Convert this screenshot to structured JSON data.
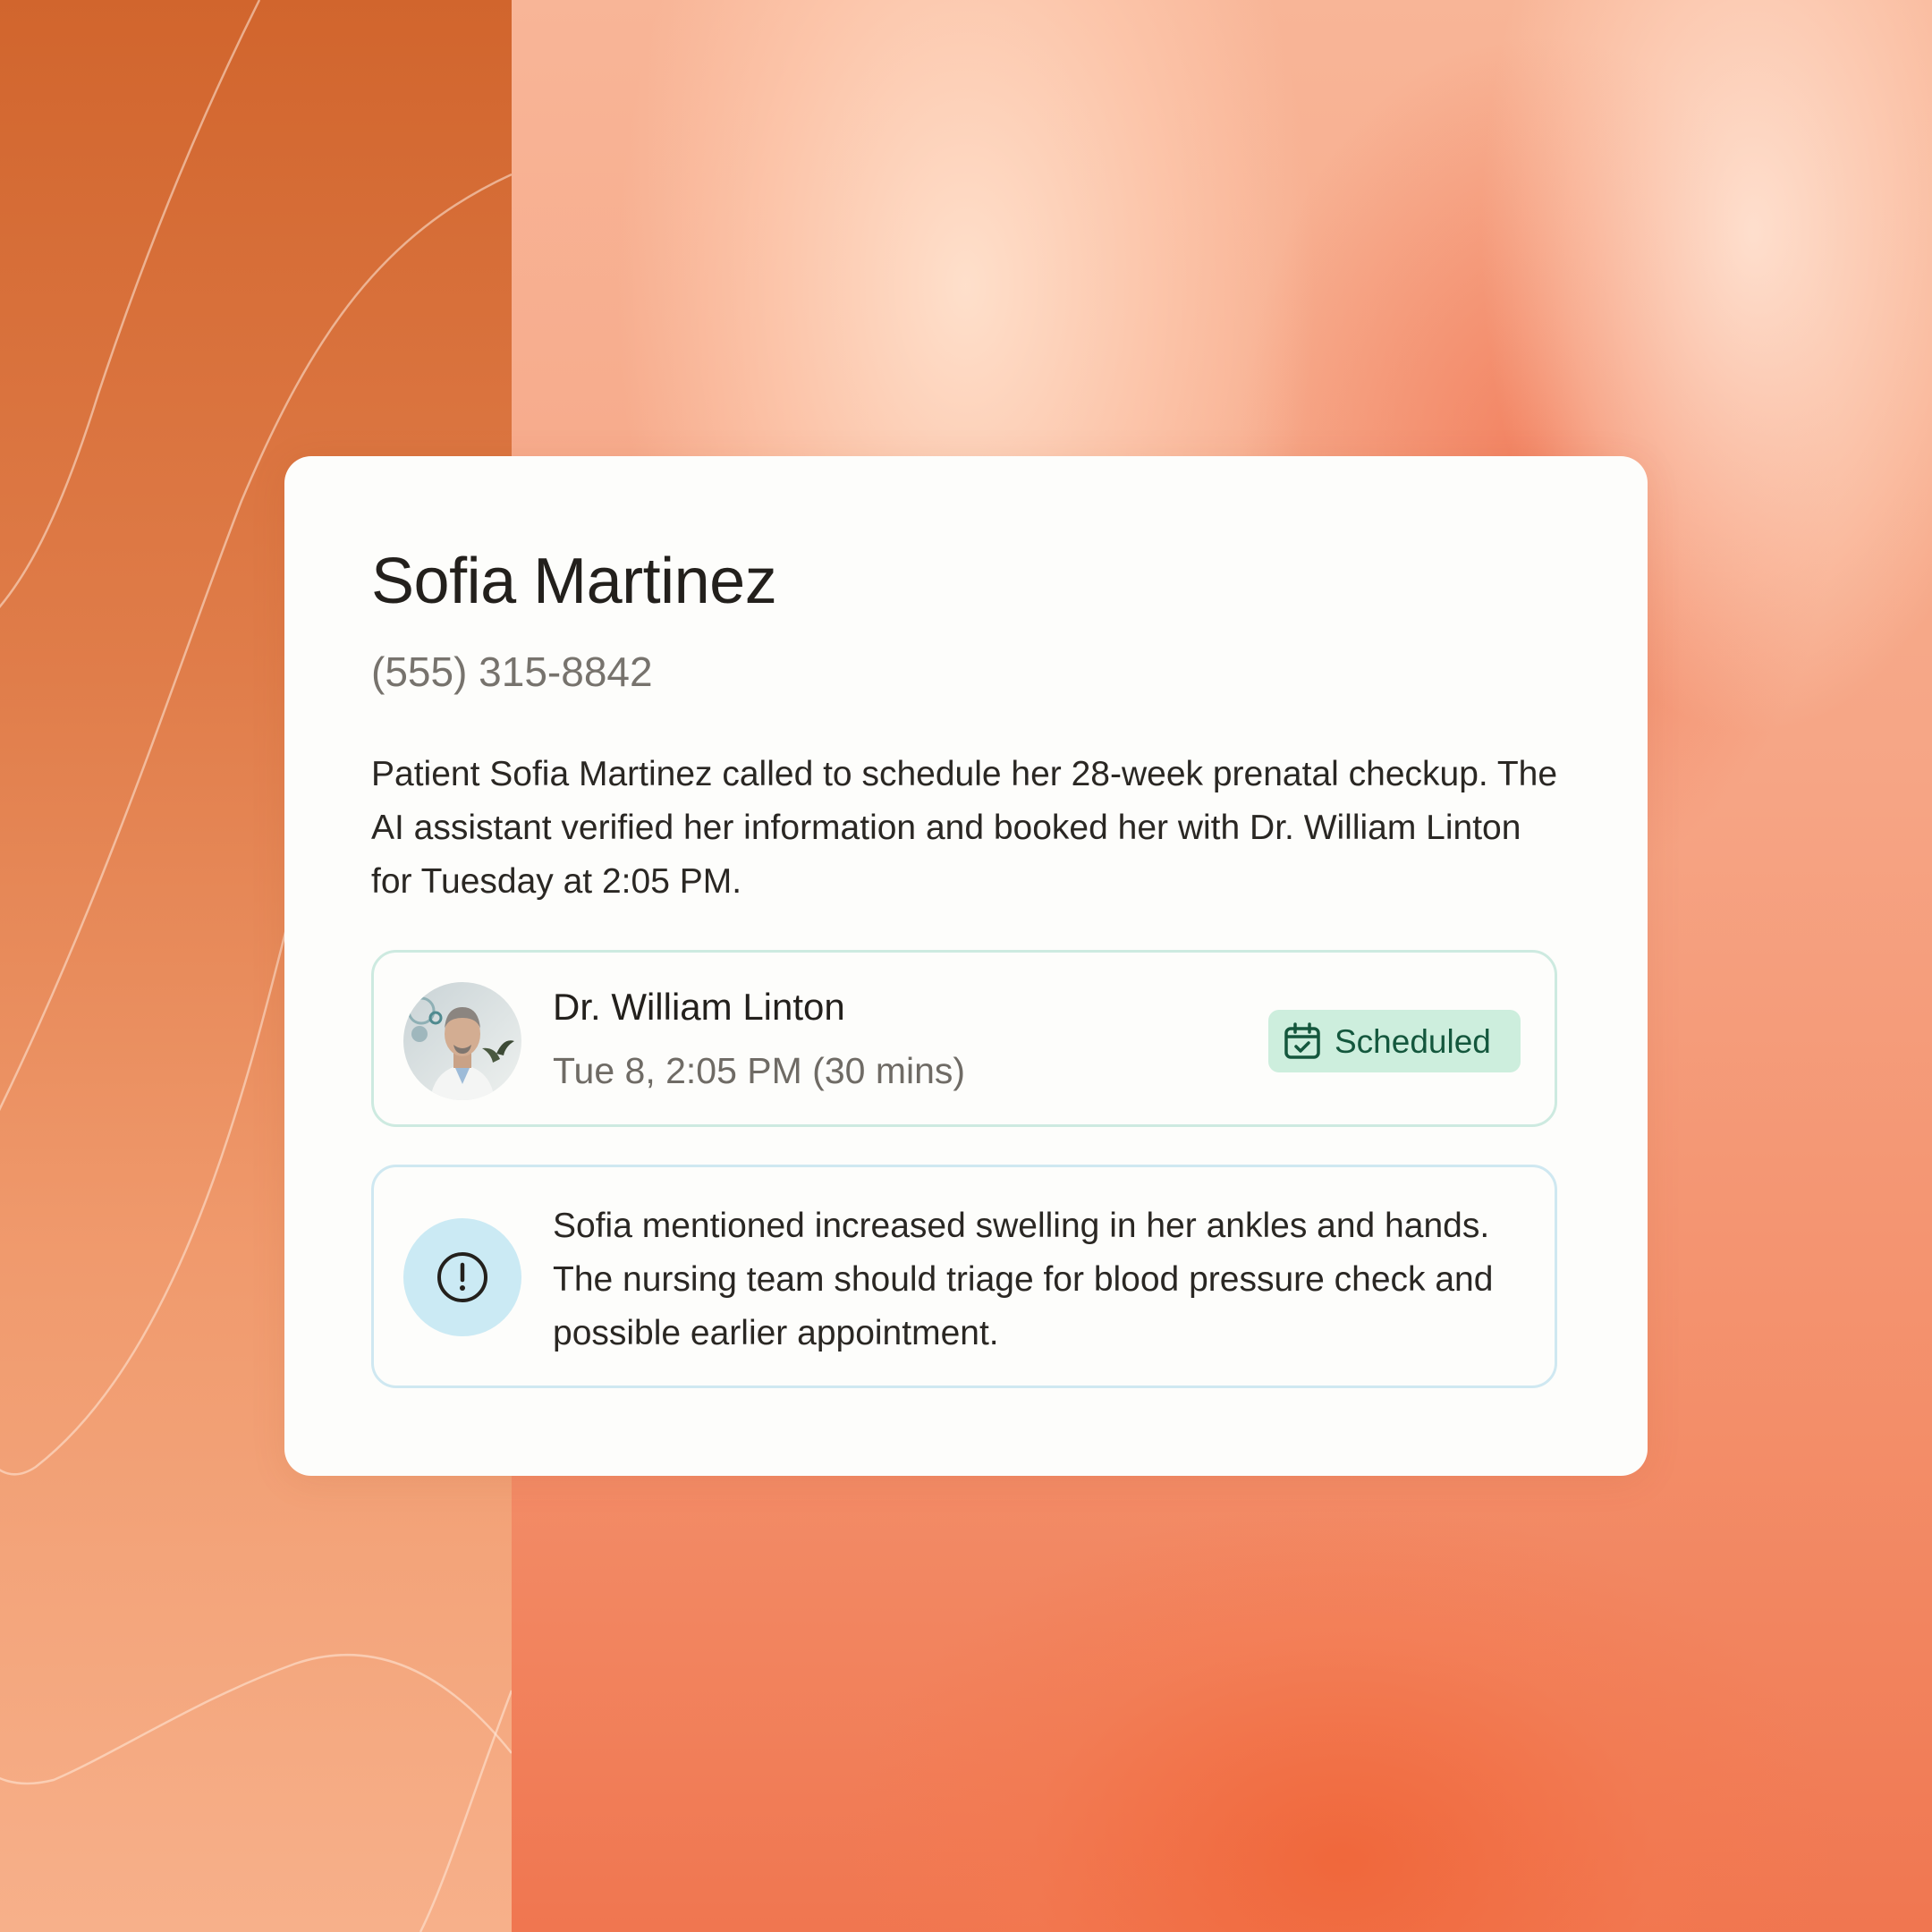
{
  "patient": {
    "name": "Sofia Martinez",
    "phone": "(555) 315-8842"
  },
  "summary": "Patient Sofia Martinez called to schedule her 28-week prenatal checkup. The AI assistant verified her information and booked her with Dr. William Linton for Tuesday at 2:05 PM.",
  "appointment": {
    "doctor_name": "Dr. William Linton",
    "time": "Tue 8, 2:05 PM (30 mins)",
    "status_label": "Scheduled",
    "status_icon": "calendar-check-icon",
    "status_color": "#14573d",
    "status_bg": "#cdeedd"
  },
  "alert": {
    "icon": "exclamation-circle-icon",
    "text": "Sofia mentioned increased swelling in her ankles and hands. The nursing team should triage for blood pressure check and possible earlier appointment."
  },
  "colors": {
    "left_panel": "#d96f38",
    "background": "#f6a585",
    "card": "#fdfdfb"
  }
}
